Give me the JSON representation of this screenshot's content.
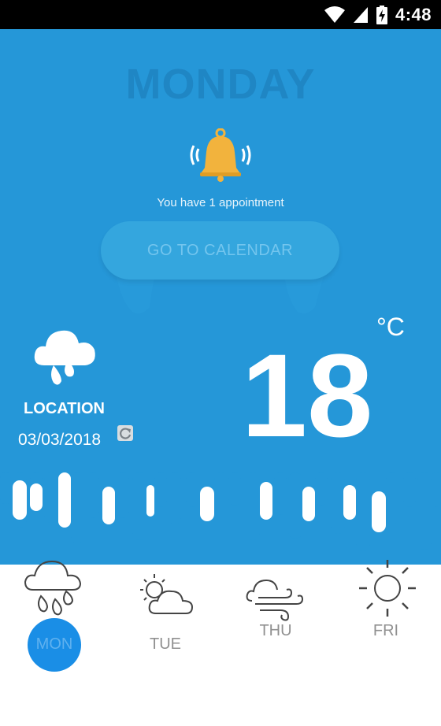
{
  "status_bar": {
    "time": "4:48"
  },
  "header": {
    "day": "MONDAY"
  },
  "notification": {
    "text": "You have 1 appointment",
    "button_label": "GO TO CALENDAR"
  },
  "current": {
    "location": "LOCATION",
    "date": "03/03/2018",
    "temperature": "18",
    "unit": "°C",
    "condition_icon": "rain-cloud-icon"
  },
  "forecast": [
    {
      "day": "MON",
      "icon": "rain-cloud-icon",
      "selected": true
    },
    {
      "day": "TUE",
      "icon": "partly-cloudy-icon",
      "selected": false
    },
    {
      "day": "THU",
      "icon": "windy-icon",
      "selected": false
    },
    {
      "day": "FRI",
      "icon": "sun-icon",
      "selected": false
    }
  ],
  "colors": {
    "primary_blue": "#2597d8",
    "bell": "#f2b33d",
    "selected_circle": "#1a8ee6"
  }
}
